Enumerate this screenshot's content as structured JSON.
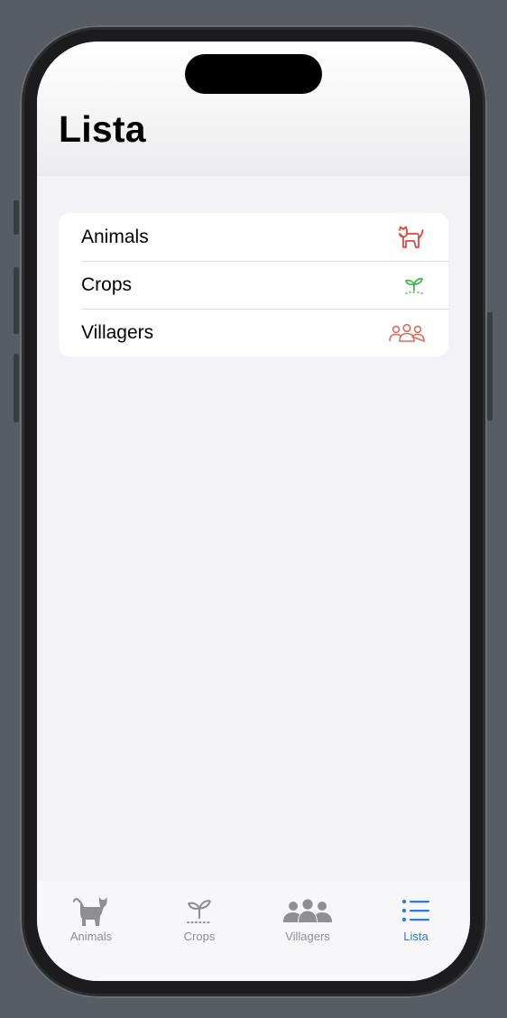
{
  "header": {
    "title": "Lista"
  },
  "list": {
    "items": [
      {
        "label": "Animals",
        "icon": "cat-icon"
      },
      {
        "label": "Crops",
        "icon": "sprout-icon"
      },
      {
        "label": "Villagers",
        "icon": "people-icon"
      }
    ]
  },
  "tabbar": {
    "tabs": [
      {
        "label": "Animals",
        "icon": "cat-icon",
        "selected": false
      },
      {
        "label": "Crops",
        "icon": "sprout-icon",
        "selected": false
      },
      {
        "label": "Villagers",
        "icon": "people-icon",
        "selected": false
      },
      {
        "label": "Lista",
        "icon": "list-icon",
        "selected": true
      }
    ]
  },
  "colors": {
    "accent": "#2f7ae5",
    "animals_icon": "#e0463c",
    "crops_icon": "#3fb24a",
    "villagers_icon": "#e06a5a",
    "tab_inactive": "#8e8e93"
  }
}
